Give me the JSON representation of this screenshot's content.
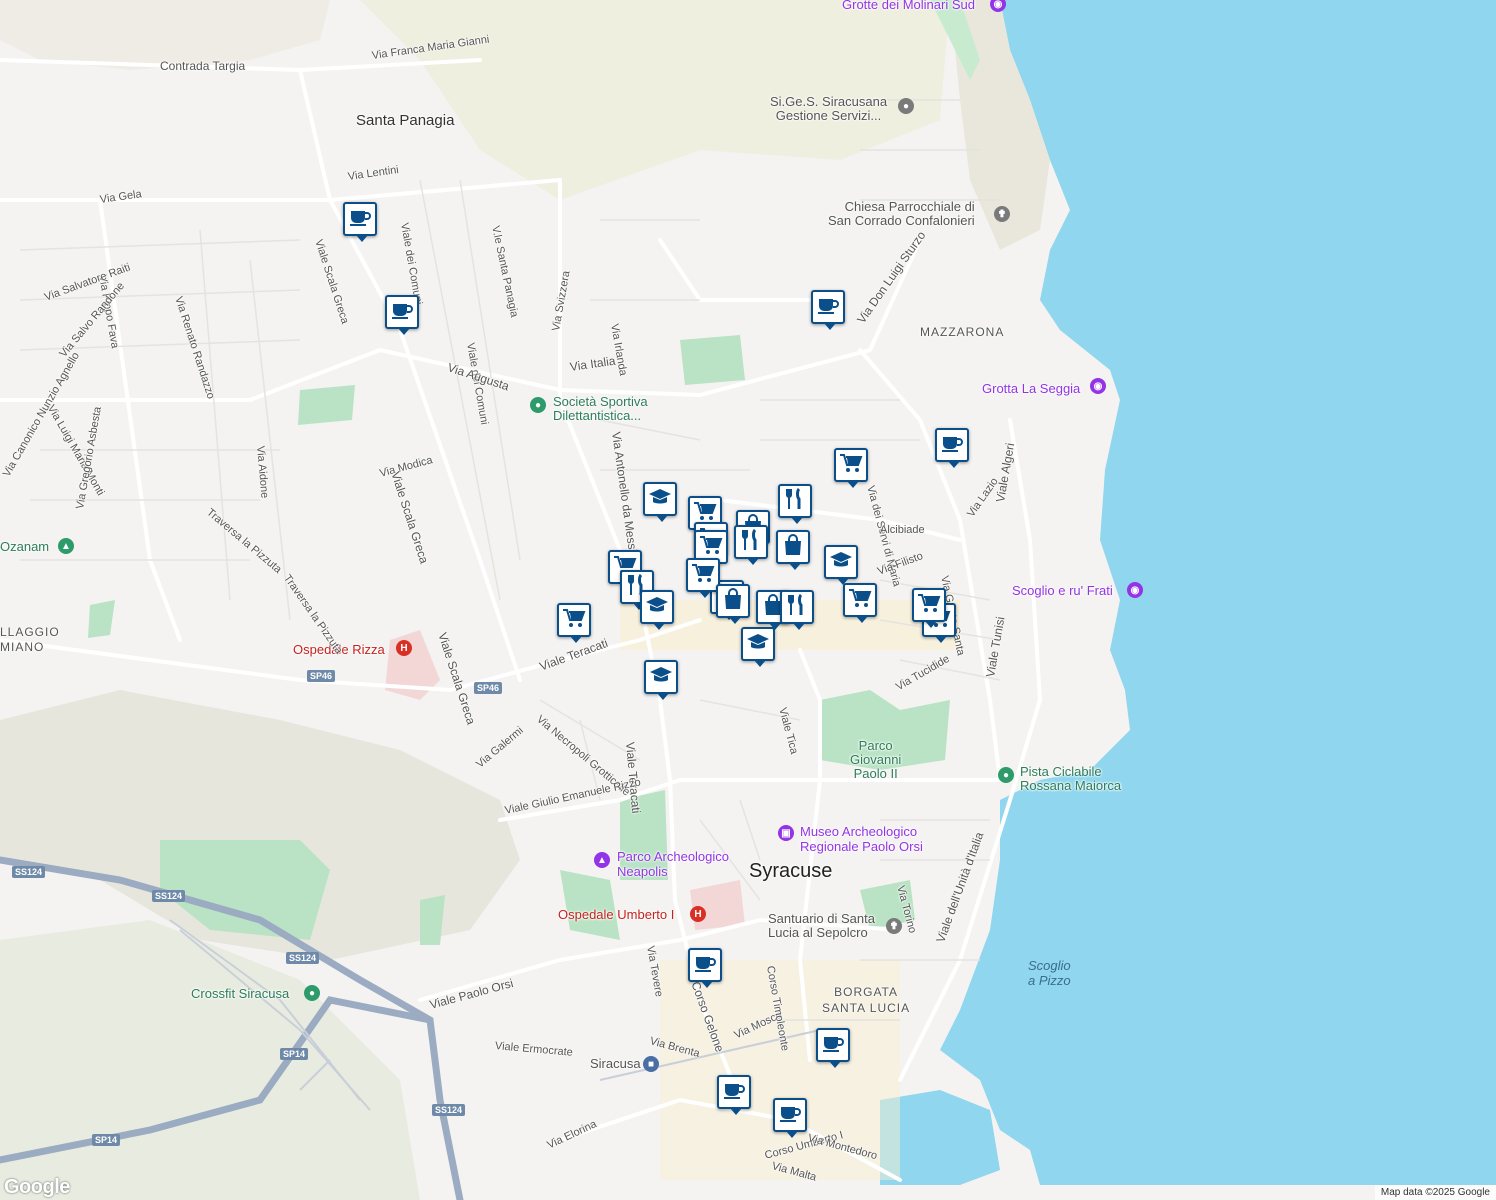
{
  "map": {
    "attribution": "Map data ©2025 Google",
    "logo": "Google",
    "colors": {
      "sea": "#8fd6ee",
      "land": "#f4f3f1",
      "park": "#c8ebd0",
      "road": "#ffffff",
      "major_road": "#9aabc2",
      "pin_border": "#0b4f8a"
    }
  },
  "areas": {
    "santa_panagia": "Santa Panagia",
    "syracuse": "Syracuse",
    "mazzarona": "MAZZARONA",
    "borgata": "BORGATA\nSANTA LUCIA",
    "villaggio": "LLAGGIO\nMIANO",
    "scoglio_pizzo": "Scoglio\na Pizzo"
  },
  "pois": {
    "grotte_molinari": "Grotte dei Molinari Sud",
    "sigess": "Si.Ge.S. Siracusana\nGestione Servizi...",
    "chiesa_corrado": "Chiesa Parrocchiale di\nSan Corrado Confalonieri",
    "grotta_seggia": "Grotta La Seggia",
    "societa_sportiva": "Società Sportiva\nDilettantistica...",
    "ozanam": "Ozanam",
    "scoglio_frati": "Scoglio e ru' Frati",
    "ospedale_rizza": "Ospedale Rizza",
    "parco_gp2": "Parco\nGiovanni\nPaolo II",
    "pista_ciclabile": "Pista Ciclabile\nRossana Maiorca",
    "museo": "Museo Archeologico\nRegionale Paolo Orsi",
    "parco_neapolis": "Parco Archeologico\nNeapolis",
    "ospedale_umberto": "Ospedale Umberto I",
    "santuario": "Santuario di Santa\nLucia al Sepolcro",
    "crossfit": "Crossfit Siracusa",
    "siracusa_station": "Siracusa"
  },
  "streets": {
    "contrada_targia": "Contrada Targia",
    "via_franca": "Via Franca Maria Gianni",
    "via_lentini": "Via Lentini",
    "via_gela": "Via Gela",
    "viale_greca": "Viale Scala Greca",
    "viale_dei_comuni": "Viale dei Comuni",
    "viale_dei_comuni2": "Viale dei Comuni",
    "vle_santa_panagia": "V.le Santa Panagia",
    "via_pippo_fava": "Via Pippo Fava",
    "via_renato": "Via Renato Randazzo",
    "via_salvatore": "Via Salvatore Raiti",
    "via_salvo": "Via Salvo Randone",
    "via_luigi": "Via Luigi Maria Monti",
    "via_canonico": "Via Canonico Nunzio Agnello",
    "via_svizzera": "Via Svizzera",
    "via_irlanda": "Via Irlanda",
    "via_augusta": "Via Augusta",
    "via_italia": "Via Italia",
    "via_antonello": "Via Antonello da Messina",
    "via_don_luigi": "Via Don Luigi Sturzo",
    "via_aidone": "Via Aidone",
    "via_modica": "Via Modica",
    "viale_scala_greca2": "Viale Scala Greca",
    "viale_scala_greca3": "Viale Scala Greca",
    "via_gregorio": "Via Gregorio Asbesta",
    "traversa1": "Traversa la Pizzuta",
    "traversa2": "Traversa la Pizzuta",
    "viale_teracati": "Viale Teracati",
    "viale_teracati2": "Viale Teracati",
    "via_necropoli": "Via Necropoli Grotticelle",
    "via_galermi": "Via Galermi",
    "viale_giulio": "Viale Giulio Emanuele Rizzo",
    "viale_tica": "Viale Tica",
    "via_tucidide": "Via Tucidide",
    "via_servi": "Via dei Servi di Maria",
    "via_lazio": "Via Lazio",
    "via_grotta_santa": "Via Grotta Santa",
    "viale_algeri": "Viale Algeri",
    "viale_tunisi": "Viale Tunisi",
    "viale_unita": "Viale dell'Unità d'Italia",
    "via_torino": "Via Torino",
    "via_alcibiade": "Alcibiade",
    "via_filisto": "Via Filisto",
    "viale_paolo_orsi": "Viale Paolo Orsi",
    "viale_ermocrate": "Viale Ermocrate",
    "via_brenta": "Via Brenta",
    "via_tevere": "Via Tevere",
    "corso_gelone": "Corso Gelone",
    "via_mosco": "Via Mosco",
    "corso_timoleonte": "Corso Timoleonte",
    "via_elorina": "Via Elorina",
    "corso_umberto": "Corso Umberto I",
    "via_malta": "Via Malta",
    "via_montedoro": "Via Montedoro"
  },
  "shields": [
    "SS124",
    "SS124",
    "SS124",
    "SS124",
    "SP14",
    "SP14",
    "SP46",
    "SP46"
  ],
  "markers": [
    {
      "icon": "coffee"
    },
    {
      "icon": "coffee"
    },
    {
      "icon": "coffee"
    },
    {
      "icon": "coffee"
    },
    {
      "icon": "cart"
    },
    {
      "icon": "school"
    },
    {
      "icon": "cart"
    },
    {
      "icon": "utensils"
    },
    {
      "icon": "cart"
    },
    {
      "icon": "bag"
    },
    {
      "icon": "cart"
    },
    {
      "icon": "utensils"
    },
    {
      "icon": "bag"
    },
    {
      "icon": "cart"
    },
    {
      "icon": "school"
    },
    {
      "icon": "utensils"
    },
    {
      "icon": "cart"
    },
    {
      "icon": "utensils"
    },
    {
      "icon": "school"
    },
    {
      "icon": "cart"
    },
    {
      "icon": "cart"
    },
    {
      "icon": "bag"
    },
    {
      "icon": "bag"
    },
    {
      "icon": "utensils"
    },
    {
      "icon": "cart"
    },
    {
      "icon": "cart"
    },
    {
      "icon": "school"
    },
    {
      "icon": "school"
    },
    {
      "icon": "coffee"
    },
    {
      "icon": "coffee"
    },
    {
      "icon": "coffee"
    },
    {
      "icon": "coffee"
    }
  ]
}
